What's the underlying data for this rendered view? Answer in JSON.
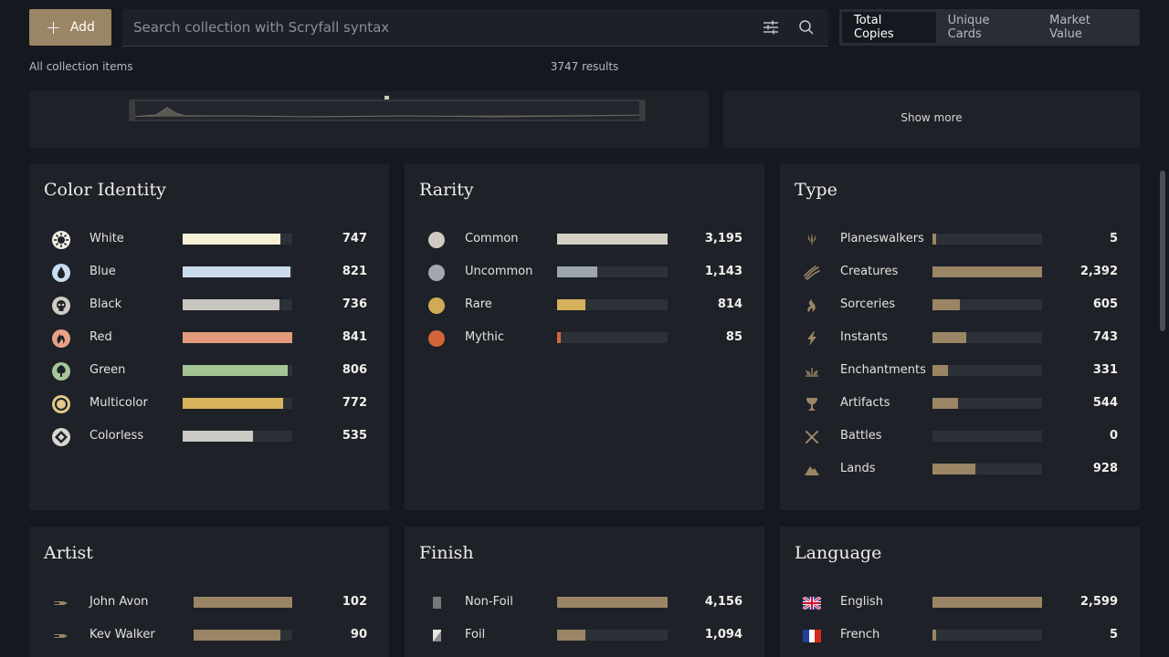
{
  "toolbar": {
    "add_label": "Add",
    "search_placeholder": "Search collection with Scryfall syntax",
    "search_value": "",
    "view_toggle": [
      "Total Copies",
      "Unique Cards",
      "Market Value"
    ],
    "active_view": "Total Copies"
  },
  "meta": {
    "scope": "All collection items",
    "results": "3747 results"
  },
  "show_more": "Show more",
  "colors": {
    "accent": "#9a8564",
    "bar_track": "#2c3037",
    "card_bg": "#1e2128",
    "page_bg": "#15181e"
  },
  "panels": {
    "color_identity": {
      "title": "Color Identity",
      "rows": [
        {
          "label": "White",
          "value": "747",
          "fraction": 0.89,
          "color": "#f6f1d6",
          "icon": "white-mana-icon"
        },
        {
          "label": "Blue",
          "value": "821",
          "fraction": 0.98,
          "color": "#c9dced",
          "icon": "blue-mana-icon"
        },
        {
          "label": "Black",
          "value": "736",
          "fraction": 0.88,
          "color": "#c8c5c0",
          "icon": "black-mana-icon"
        },
        {
          "label": "Red",
          "value": "841",
          "fraction": 1.0,
          "color": "#e39a7b",
          "icon": "red-mana-icon"
        },
        {
          "label": "Green",
          "value": "806",
          "fraction": 0.96,
          "color": "#a4c495",
          "icon": "green-mana-icon"
        },
        {
          "label": "Multicolor",
          "value": "772",
          "fraction": 0.92,
          "color": "#d9b35c",
          "icon": "multicolor-icon"
        },
        {
          "label": "Colorless",
          "value": "535",
          "fraction": 0.64,
          "color": "#cbc9c4",
          "icon": "colorless-icon"
        }
      ]
    },
    "rarity": {
      "title": "Rarity",
      "rows": [
        {
          "label": "Common",
          "value": "3,195",
          "fraction": 1.0,
          "color": "#d3cfc4",
          "dot": "#cfcbc1"
        },
        {
          "label": "Uncommon",
          "value": "1,143",
          "fraction": 0.36,
          "color": "#9ea6b0",
          "dot": "#a2a8b0"
        },
        {
          "label": "Rare",
          "value": "814",
          "fraction": 0.26,
          "color": "#d6b05a",
          "dot": "#d1aa55"
        },
        {
          "label": "Mythic",
          "value": "85",
          "fraction": 0.03,
          "color": "#d6683f",
          "dot": "#d4643a"
        }
      ]
    },
    "type": {
      "title": "Type",
      "rows": [
        {
          "label": "Planeswalkers",
          "value": "5",
          "fraction": 0.03,
          "icon": "planeswalker-icon"
        },
        {
          "label": "Creatures",
          "value": "2,392",
          "fraction": 1.0,
          "icon": "creature-claw-icon"
        },
        {
          "label": "Sorceries",
          "value": "605",
          "fraction": 0.25,
          "icon": "sorcery-icon"
        },
        {
          "label": "Instants",
          "value": "743",
          "fraction": 0.31,
          "icon": "instant-bolt-icon"
        },
        {
          "label": "Enchantments",
          "value": "331",
          "fraction": 0.14,
          "icon": "enchantment-icon"
        },
        {
          "label": "Artifacts",
          "value": "544",
          "fraction": 0.23,
          "icon": "artifact-chalice-icon"
        },
        {
          "label": "Battles",
          "value": "0",
          "fraction": 0.0,
          "icon": "battle-swords-icon"
        },
        {
          "label": "Lands",
          "value": "928",
          "fraction": 0.39,
          "icon": "land-mountain-icon"
        }
      ]
    },
    "artist": {
      "title": "Artist",
      "rows": [
        {
          "label": "John Avon",
          "value": "102",
          "fraction": 1.0,
          "icon": "paintbrush-icon"
        },
        {
          "label": "Kev Walker",
          "value": "90",
          "fraction": 0.88,
          "icon": "paintbrush-icon"
        }
      ]
    },
    "finish": {
      "title": "Finish",
      "rows": [
        {
          "label": "Non-Foil",
          "value": "4,156",
          "fraction": 1.0,
          "icon": "non-foil-card-icon"
        },
        {
          "label": "Foil",
          "value": "1,094",
          "fraction": 0.26,
          "icon": "foil-card-icon"
        }
      ]
    },
    "language": {
      "title": "Language",
      "rows": [
        {
          "label": "English",
          "value": "2,599",
          "fraction": 1.0,
          "icon": "uk-flag-icon"
        },
        {
          "label": "French",
          "value": "5",
          "fraction": 0.03,
          "icon": "france-flag-icon"
        }
      ]
    }
  }
}
